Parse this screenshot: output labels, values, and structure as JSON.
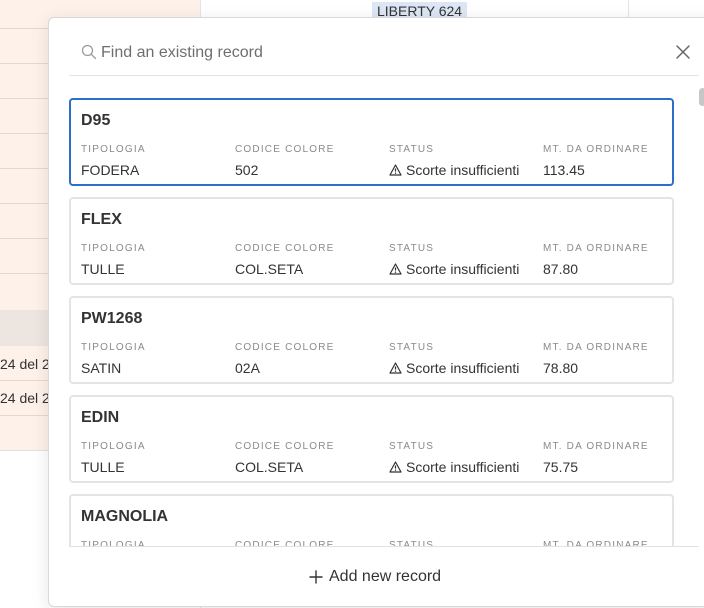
{
  "background": {
    "tag_label": "LIBERTY 624",
    "row_snippets": [
      "24 del 2",
      "24 del 2"
    ]
  },
  "search": {
    "placeholder": "Find an existing record",
    "value": ""
  },
  "field_labels": {
    "tipologia": "TIPOLOGIA",
    "codice_colore": "CODICE COLORE",
    "status": "STATUS",
    "mt_da_ordinare": "MT. DA ORDINARE"
  },
  "records": [
    {
      "name": "D95",
      "tipologia": "FODERA",
      "codice_colore": "502",
      "status": "Scorte insufficienti",
      "mt_da_ordinare": "113.45"
    },
    {
      "name": "FLEX",
      "tipologia": "TULLE",
      "codice_colore": "COL.SETA",
      "status": "Scorte insufficienti",
      "mt_da_ordinare": "87.80"
    },
    {
      "name": "PW1268",
      "tipologia": "SATIN",
      "codice_colore": "02A",
      "status": "Scorte insufficienti",
      "mt_da_ordinare": "78.80"
    },
    {
      "name": "EDIN",
      "tipologia": "TULLE",
      "codice_colore": "COL.SETA",
      "status": "Scorte insufficienti",
      "mt_da_ordinare": "75.75"
    },
    {
      "name": "MAGNOLIA",
      "tipologia": "",
      "codice_colore": "",
      "status": "",
      "mt_da_ordinare": ""
    }
  ],
  "footer": {
    "add_label": "Add new record"
  },
  "icons": {
    "search": "search-icon",
    "close": "close-icon",
    "status": "warning-icon",
    "add": "plus-icon"
  },
  "colors": {
    "selected_border": "#2d6ec8",
    "card_border": "#e4e4e4",
    "background_row": "#fdf1e9",
    "tag_bg": "#dce6f4"
  }
}
